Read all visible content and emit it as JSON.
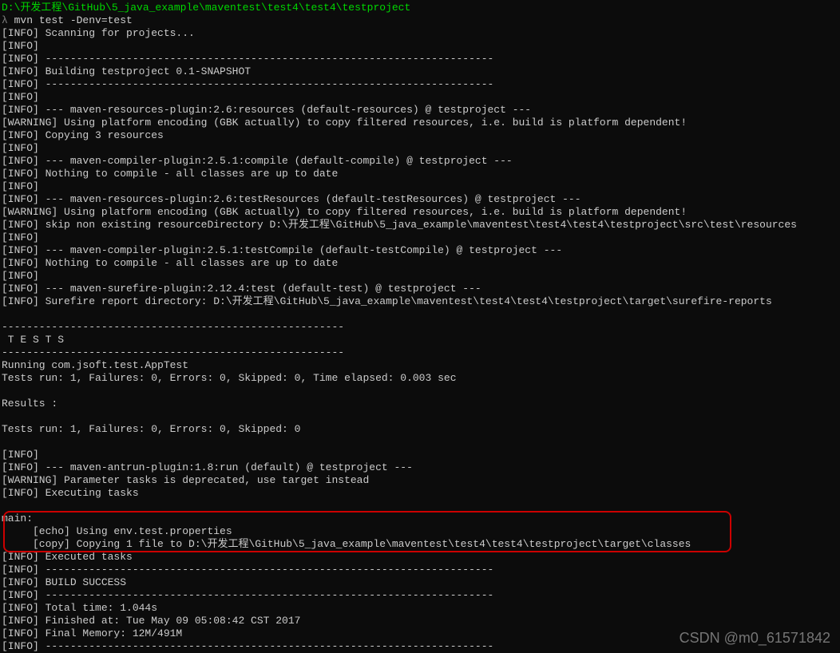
{
  "prompt": {
    "path": "D:\\开发工程\\GitHub\\5_java_example\\maventest\\test4\\test4\\testproject",
    "symbol": "λ",
    "command": " mvn test -Denv=test"
  },
  "lines": [
    "[INFO] Scanning for projects...",
    "[INFO]",
    "[INFO] ------------------------------------------------------------------------",
    "[INFO] Building testproject 0.1-SNAPSHOT",
    "[INFO] ------------------------------------------------------------------------",
    "[INFO]",
    "[INFO] --- maven-resources-plugin:2.6:resources (default-resources) @ testproject ---",
    "[WARNING] Using platform encoding (GBK actually) to copy filtered resources, i.e. build is platform dependent!",
    "[INFO] Copying 3 resources",
    "[INFO]",
    "[INFO] --- maven-compiler-plugin:2.5.1:compile (default-compile) @ testproject ---",
    "[INFO] Nothing to compile - all classes are up to date",
    "[INFO]",
    "[INFO] --- maven-resources-plugin:2.6:testResources (default-testResources) @ testproject ---",
    "[WARNING] Using platform encoding (GBK actually) to copy filtered resources, i.e. build is platform dependent!",
    "[INFO] skip non existing resourceDirectory D:\\开发工程\\GitHub\\5_java_example\\maventest\\test4\\test4\\testproject\\src\\test\\resources",
    "[INFO]",
    "[INFO] --- maven-compiler-plugin:2.5.1:testCompile (default-testCompile) @ testproject ---",
    "[INFO] Nothing to compile - all classes are up to date",
    "[INFO]",
    "[INFO] --- maven-surefire-plugin:2.12.4:test (default-test) @ testproject ---",
    "[INFO] Surefire report directory: D:\\开发工程\\GitHub\\5_java_example\\maventest\\test4\\test4\\testproject\\target\\surefire-reports",
    "",
    "-------------------------------------------------------",
    " T E S T S",
    "-------------------------------------------------------",
    "Running com.jsoft.test.AppTest",
    "Tests run: 1, Failures: 0, Errors: 0, Skipped: 0, Time elapsed: 0.003 sec",
    "",
    "Results :",
    "",
    "Tests run: 1, Failures: 0, Errors: 0, Skipped: 0",
    "",
    "[INFO]",
    "[INFO] --- maven-antrun-plugin:1.8:run (default) @ testproject ---",
    "[WARNING] Parameter tasks is deprecated, use target instead",
    "[INFO] Executing tasks",
    ""
  ],
  "highlighted": [
    "main:",
    "     [echo] Using env.test.properties",
    "     [copy] Copying 1 file to D:\\开发工程\\GitHub\\5_java_example\\maventest\\test4\\test4\\testproject\\target\\classes"
  ],
  "lines_after": [
    "[INFO] Executed tasks",
    "[INFO] ------------------------------------------------------------------------",
    "[INFO] BUILD SUCCESS",
    "[INFO] ------------------------------------------------------------------------",
    "[INFO] Total time: 1.044s",
    "[INFO] Finished at: Tue May 09 05:08:42 CST 2017",
    "[INFO] Final Memory: 12M/491M",
    "[INFO] ------------------------------------------------------------------------"
  ],
  "watermark": "CSDN @m0_61571842"
}
